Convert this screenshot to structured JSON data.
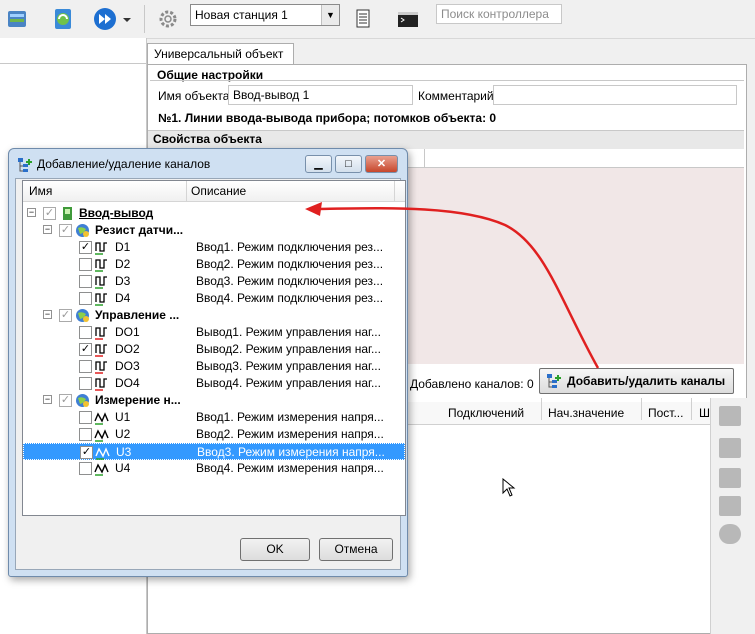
{
  "toolbar": {
    "station_combo": "Новая станция 1",
    "search_placeholder": "Поиск контроллера"
  },
  "tab": {
    "label": "Универсальный объект"
  },
  "general": {
    "title": "Общие настройки",
    "name_label": "Имя объекта",
    "name_value": "Ввод-вывод 1",
    "comment_label": "Комментарий",
    "comment_value": "",
    "info": "№1. Линии ввода-вывода прибора; потомков объекта: 0"
  },
  "properties": {
    "title": "Свойства объекта"
  },
  "channels": {
    "added": "Добавлено каналов: 0",
    "add_remove_button": "Добавить/удалить каналы"
  },
  "grid": {
    "columns": [
      "Подключений",
      "Нач.значение",
      "Пост...",
      "Ш"
    ]
  },
  "dialog": {
    "title": "Добавление/удаление каналов",
    "col_name": "Имя",
    "col_desc": "Описание",
    "root": "Ввод-вывод",
    "groups": [
      {
        "name": "Резист датчи...",
        "items": [
          {
            "name": "D1",
            "desc": "Ввод1. Режим подключения рез...",
            "checked": true
          },
          {
            "name": "D2",
            "desc": "Ввод2. Режим подключения рез...",
            "checked": false
          },
          {
            "name": "D3",
            "desc": "Ввод3. Режим подключения рез...",
            "checked": false
          },
          {
            "name": "D4",
            "desc": "Ввод4. Режим подключения рез...",
            "checked": false
          }
        ]
      },
      {
        "name": "Управление ...",
        "items": [
          {
            "name": "DO1",
            "desc": "Вывод1. Режим управления наг...",
            "checked": false
          },
          {
            "name": "DO2",
            "desc": "Вывод2. Режим управления наг...",
            "checked": true
          },
          {
            "name": "DO3",
            "desc": "Вывод3. Режим управления наг...",
            "checked": false
          },
          {
            "name": "DO4",
            "desc": "Вывод4. Режим управления наг...",
            "checked": false
          }
        ]
      },
      {
        "name": "Измерение н...",
        "items": [
          {
            "name": "U1",
            "desc": "Ввод1. Режим измерения напря...",
            "checked": false
          },
          {
            "name": "U2",
            "desc": "Ввод2. Режим измерения напря...",
            "checked": false
          },
          {
            "name": "U3",
            "desc": "Ввод3. Режим измерения напря...",
            "checked": true
          },
          {
            "name": "U4",
            "desc": "Ввод4. Режим измерения напря...",
            "checked": false
          }
        ]
      }
    ],
    "ok": "OK",
    "cancel": "Отмена"
  },
  "colors": {
    "selection": "#3399ff",
    "arrow": "#e02020",
    "pink": "#f1e7e7"
  }
}
